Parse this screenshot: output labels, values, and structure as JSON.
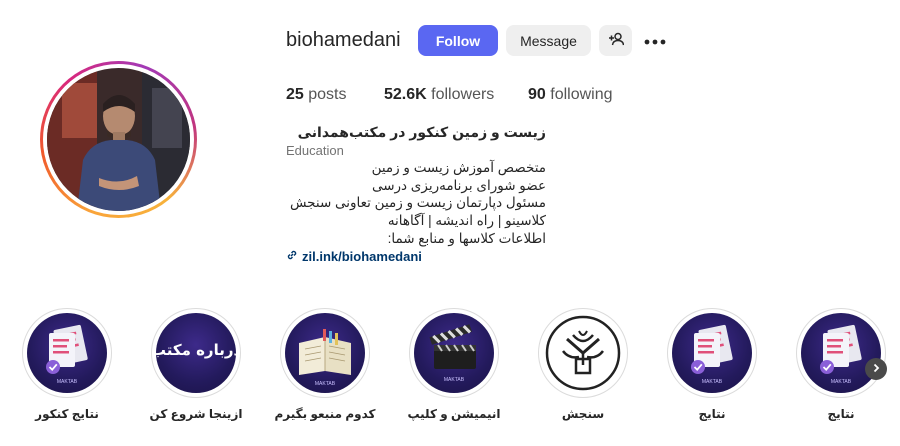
{
  "profile": {
    "username": "biohamedani",
    "follow_label": "Follow",
    "message_label": "Message"
  },
  "stats": {
    "posts_count": "25",
    "posts_label": "posts",
    "followers_count": "52.6K",
    "followers_label": "followers",
    "following_count": "90",
    "following_label": "following"
  },
  "bio": {
    "name": "زیست و زمین کنکور در مکتب‌همدانی",
    "category": "Education",
    "lines": [
      "متخصص آموزش زیست و زمین",
      "عضو شورای برنامه‌ریزی درسی",
      "مسئول دپارتمان زیست و زمین تعاونی سنجش",
      "کلاسینو | راه اندیشه | آگاهانه",
      "اطلاعات کلاسها و منابع شما:"
    ],
    "link": "zil.ink/biohamedani"
  },
  "highlights": [
    {
      "label": "نتایج",
      "cover_text": "MAKTAB"
    },
    {
      "label": "نتایج",
      "cover_text": "MAKTAB"
    },
    {
      "label": "سنجش",
      "cover_text": ""
    },
    {
      "label": "انیمیشن و کلیپ",
      "cover_text": "MAKTAB"
    },
    {
      "label": "کدوم منبعو بگیرم",
      "cover_text": "MAKTAB"
    },
    {
      "label": "ازینجا شروع کن",
      "cover_text": "درباره مکتب"
    },
    {
      "label": "نتایج کنکور",
      "cover_text": "MAKTAB"
    }
  ],
  "colors": {
    "follow_button": "#5a67f2",
    "link": "#00376b",
    "highlight_purple": "#231a5c"
  },
  "icons": [
    "add-user-icon",
    "more-icon",
    "link-icon",
    "chevron-right-icon"
  ]
}
